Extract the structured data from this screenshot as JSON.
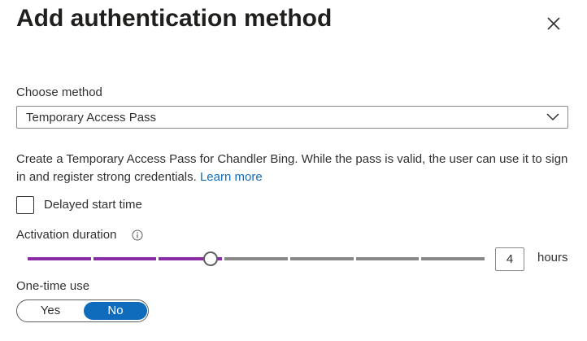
{
  "dialog": {
    "title": "Add authentication method"
  },
  "choose_method": {
    "label": "Choose method",
    "selected": "Temporary Access Pass"
  },
  "description": {
    "text": "Create a Temporary Access Pass for Chandler Bing. While the pass is valid, the user can use it to sign in and register strong credentials.",
    "link": "Learn more"
  },
  "delayed_start": {
    "label": "Delayed start time",
    "checked": false
  },
  "activation_duration": {
    "label": "Activation duration",
    "value": "4",
    "unit": "hours",
    "slider_value": 4,
    "slider_max": 10
  },
  "one_time_use": {
    "label": "One-time use",
    "options": [
      "Yes",
      "No"
    ],
    "selected": "No"
  },
  "colors": {
    "accent": "#0f6cbd",
    "slider_filled": "#8a2da5",
    "slider_track": "#8a8886"
  }
}
